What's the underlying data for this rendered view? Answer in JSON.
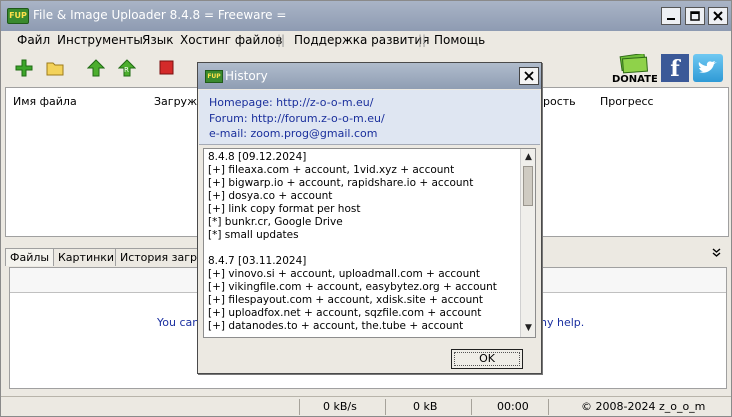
{
  "window": {
    "title": "File & Image Uploader 8.4.8  = Freeware =",
    "icon_label": "FUP"
  },
  "menu": {
    "items": [
      "Файл",
      "Инструменты",
      "Язык",
      "Хостинг файлов",
      "Поддержка развития",
      "Помощь"
    ],
    "separator": "||"
  },
  "toolbar": {
    "donate_label": "DONATE",
    "icons": [
      "add-file-icon",
      "open-folder-icon",
      "upload-up-icon",
      "refresh-upload-icon",
      "stop-icon"
    ]
  },
  "filelist": {
    "columns": [
      "Имя файла",
      "Загруже",
      "рость",
      "Прогресс"
    ]
  },
  "tabs": [
    "Файлы",
    "Картинки",
    "История загруз"
  ],
  "lower": {
    "help_left": "You can",
    "help_right": "ny help."
  },
  "status": {
    "speed": "0 kB/s",
    "size": "0 kB",
    "time": "00:00",
    "copyright": "© 2008-2024 z_o_o_m"
  },
  "dialog": {
    "title": "History",
    "icon_label": "FUP",
    "homepage": "Homepage: http://z-o-o-m.eu/",
    "forum": "Forum: http://forum.z-o-o-m.eu/",
    "email": "e-mail: zoom.prog@gmail.com",
    "history": [
      "8.4.8 [09.12.2024]",
      "[+] fileaxa.com + account, 1vid.xyz + account",
      "[+] bigwarp.io + account, rapidshare.io + account",
      "[+] dosya.co + account",
      "[+] link copy format per host",
      "[*] bunkr.cr, Google Drive",
      "[*] small updates",
      "",
      "8.4.7 [03.11.2024]",
      "[+] vinovo.si + account, uploadmall.com + account",
      "[+] vikingfile.com + account, easybytez.org + account",
      "[+] filespayout.com + account, xdisk.site + account",
      "[+] uploadfox.net + account, sqzfile.com + account",
      "[+] datanodes.to + account, the.tube + account"
    ],
    "ok_label": "OK"
  },
  "colors": {
    "title_bar": "#98a5bb",
    "link_blue": "#1a2f9c",
    "info_bg": "#dfe6f2"
  }
}
